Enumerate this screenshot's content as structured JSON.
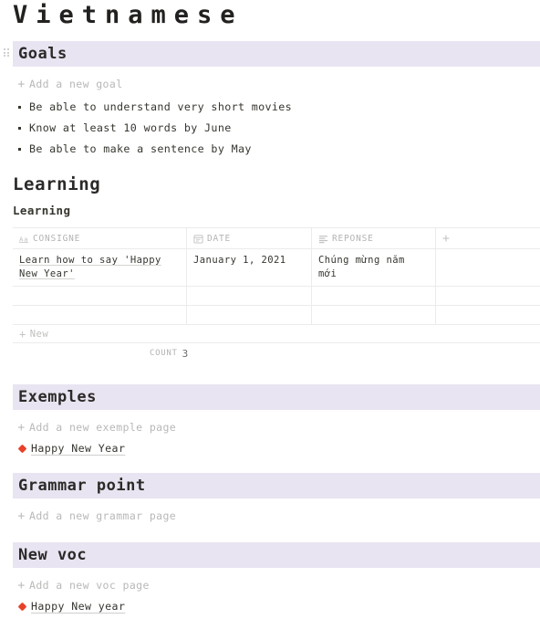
{
  "page": {
    "title": "Vietnamese"
  },
  "theme": {
    "band_color": "#e9e4f1",
    "text_color": "#37352f",
    "muted_color": "#b9b8b6",
    "accent_color": "#e8412a",
    "border_color": "#ecebea"
  },
  "sections": {
    "goals": {
      "title": "Goals",
      "add_label": "Add a new goal",
      "plus": "+",
      "items": [
        "Be able to understand very short movies",
        "Know at least 10 words by June",
        "Be able to make a sentence by May"
      ]
    },
    "learning": {
      "heading": "Learning",
      "subheading": "Learning",
      "table": {
        "columns": [
          {
            "label": "CONSIGNE",
            "icon": "title-aa-icon"
          },
          {
            "label": "DATE",
            "icon": "calendar-icon"
          },
          {
            "label": "REPONSE",
            "icon": "text-lines-icon"
          },
          {
            "label": "+",
            "icon": "plus-icon"
          }
        ],
        "rows": [
          {
            "consigne": "Learn how to say 'Happy New Year'",
            "date": "January 1, 2021",
            "reponse": "Chúng mừng năm mới"
          },
          {
            "consigne": "",
            "date": "",
            "reponse": ""
          },
          {
            "consigne": "",
            "date": "",
            "reponse": ""
          }
        ],
        "new_row_label": "New",
        "new_row_plus": "+",
        "count_label": "COUNT",
        "count_value": "3"
      }
    },
    "exemples": {
      "title": "Exemples",
      "add_label": "Add a new exemple page",
      "plus": "+",
      "pages": [
        {
          "label": "Happy New Year",
          "icon": "red-diamond-page-icon"
        }
      ]
    },
    "grammar": {
      "title": "Grammar point",
      "add_label": "Add a new grammar page",
      "plus": "+",
      "pages": []
    },
    "newvoc": {
      "title": "New voc",
      "add_label": "Add a new voc page",
      "plus": "+",
      "pages": [
        {
          "label": "Happy New year",
          "icon": "red-diamond-page-icon"
        }
      ]
    }
  }
}
